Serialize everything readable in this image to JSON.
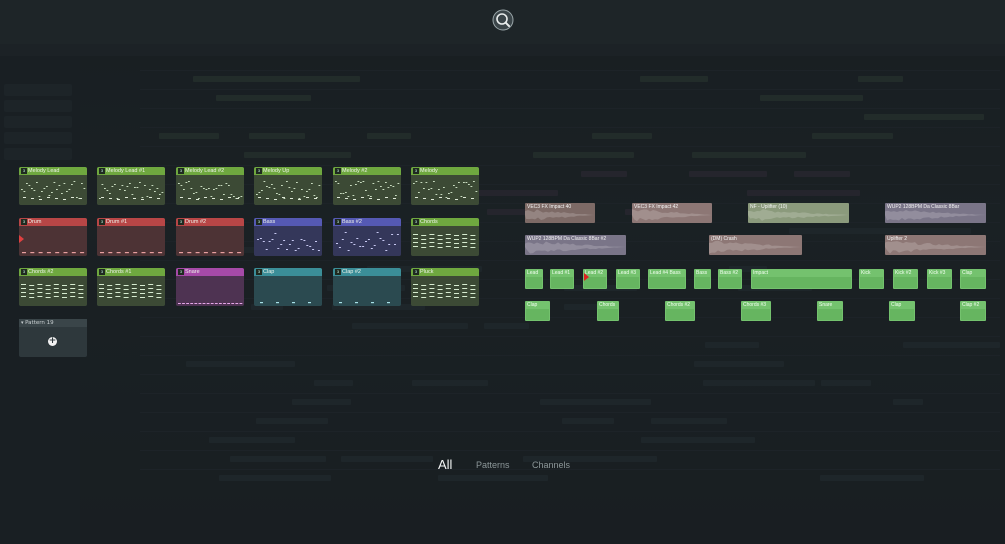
{
  "patterns": {
    "tiles": [
      {
        "num": "3",
        "label": "Melody Lead",
        "color": "green",
        "kind": "notes"
      },
      {
        "num": "3",
        "label": "Melody Lead #1",
        "color": "green",
        "kind": "notes"
      },
      {
        "num": "3",
        "label": "Melody Lead #2",
        "color": "green",
        "kind": "notes"
      },
      {
        "num": "3",
        "label": "Melody Up",
        "color": "green",
        "kind": "notes"
      },
      {
        "num": "3",
        "label": "Melody #2",
        "color": "green",
        "kind": "notes"
      },
      {
        "num": "3",
        "label": "Melody",
        "color": "green",
        "kind": "notes"
      },
      {
        "num": "3",
        "label": "Drum",
        "color": "red",
        "kind": "drum"
      },
      {
        "num": "3",
        "label": "Drum #1",
        "color": "red",
        "kind": "drum"
      },
      {
        "num": "3",
        "label": "Drum #2",
        "color": "red",
        "kind": "drum"
      },
      {
        "num": "3",
        "label": "Bass",
        "color": "blue",
        "kind": "bass"
      },
      {
        "num": "3",
        "label": "Bass #2",
        "color": "blue",
        "kind": "bass"
      },
      {
        "num": "3",
        "label": "Chords",
        "color": "green",
        "kind": "chords"
      },
      {
        "num": "3",
        "label": "Chords #2",
        "color": "green",
        "kind": "chords"
      },
      {
        "num": "3",
        "label": "Chords #1",
        "color": "green",
        "kind": "chords"
      },
      {
        "num": "3",
        "label": "Snare",
        "color": "purple",
        "kind": "snare"
      },
      {
        "num": "3",
        "label": "Clap",
        "color": "teal",
        "kind": "clap"
      },
      {
        "num": "3",
        "label": "Clap #2",
        "color": "teal",
        "kind": "clap"
      },
      {
        "num": "3",
        "label": "Pluck",
        "color": "green",
        "kind": "chords"
      }
    ],
    "empty_tile_label": "Pattern 19",
    "add_symbol": "+"
  },
  "audio_clips": [
    {
      "label": "VEC3 FX Impact 40",
      "color": "#7d6a66"
    },
    {
      "label": "VEC3 FX Impact 42",
      "color": "#8d7775"
    },
    {
      "label": "NF - Uplifter (10)",
      "color": "#8b9a7c"
    },
    {
      "label": "WUP2 128BPM Da Classic 8Bar",
      "color": "#7a7588"
    },
    {
      "label": "WUP2 128BPM Da Classic 8Bar #2",
      "color": "#7a7588"
    },
    {
      "label": "(DM) Crash",
      "color": "#8d7775"
    },
    {
      "label": "Uplifter 2",
      "color": "#8d7775"
    }
  ],
  "pattern_clips": [
    {
      "label": "Lead"
    },
    {
      "label": "Lead #1"
    },
    {
      "label": "Lead #2"
    },
    {
      "label": "Lead #3"
    },
    {
      "label": "Lead #4 Bass"
    },
    {
      "label": "Bass"
    },
    {
      "label": "Bass #2"
    },
    {
      "label": "Impact"
    },
    {
      "label": "Kick"
    },
    {
      "label": "Kick #2"
    },
    {
      "label": "Kick #3"
    },
    {
      "label": "Clap"
    },
    {
      "label": "Clap"
    },
    {
      "label": "Chords"
    },
    {
      "label": "Chords #2"
    },
    {
      "label": "Chords #3"
    },
    {
      "label": "Snare"
    },
    {
      "label": "Clap"
    },
    {
      "label": "Clap #2"
    }
  ],
  "filter_tabs": {
    "all": "All",
    "patterns": "Patterns",
    "channels": "Channels"
  },
  "colors": {
    "accent_green": "#74c26e",
    "drum_red": "#b84646",
    "bass_blue": "#5559b4",
    "snare_purple": "#a64aa8",
    "clap_teal": "#3b8e98"
  }
}
